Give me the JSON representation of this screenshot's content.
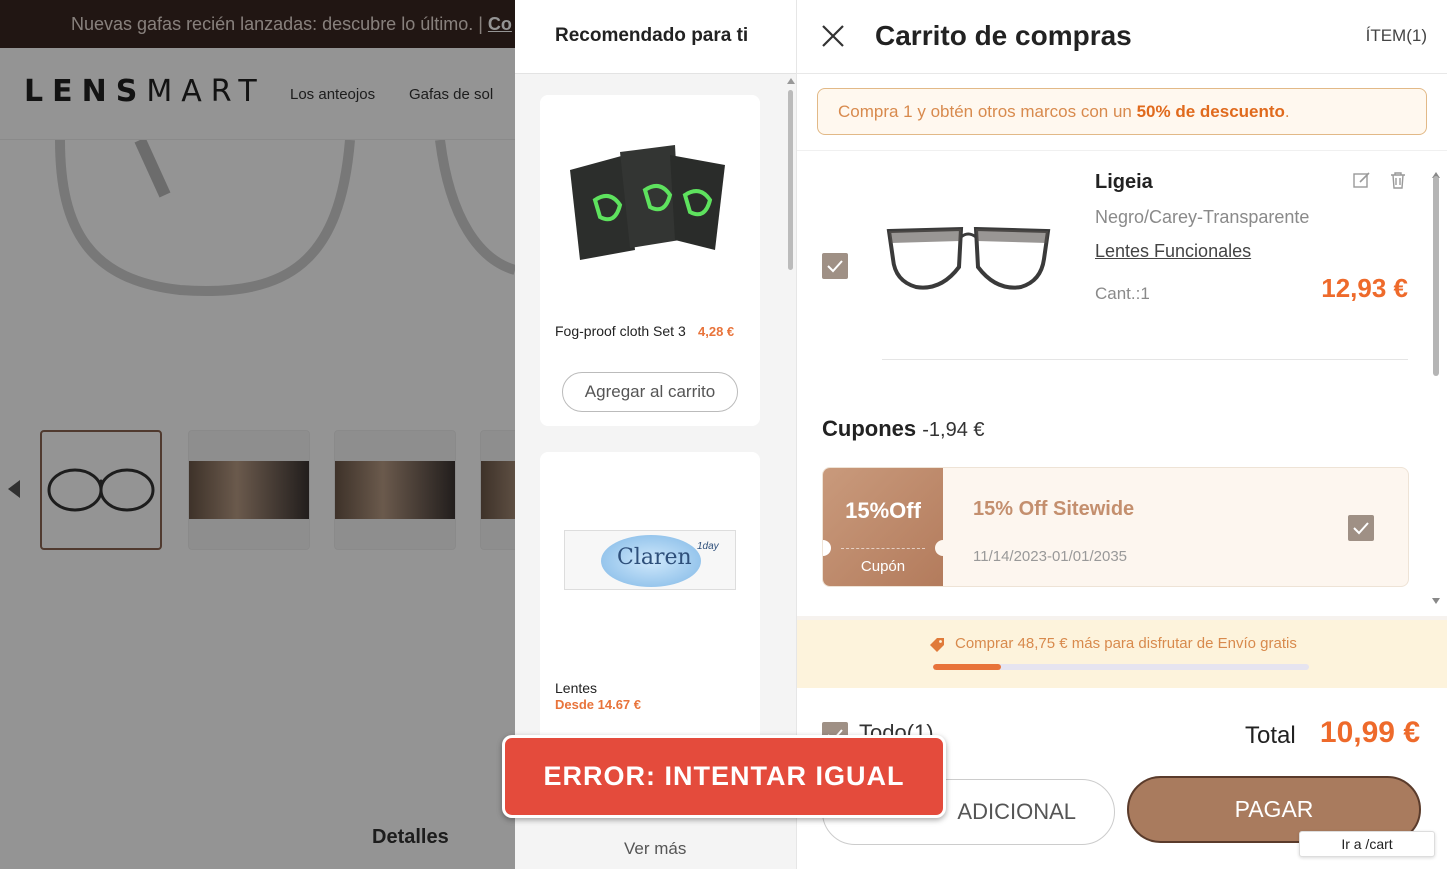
{
  "background": {
    "announcement": "Nuevas gafas recién lanzadas: descubre lo último. | ",
    "announcement_cta": "Co",
    "logo_bold": "LENS",
    "logo_thin": "MART",
    "nav": [
      "Los anteojos",
      "Gafas de sol"
    ],
    "details_tab": "Detalles"
  },
  "recommendations": {
    "title": "Recomendado para ti",
    "products": [
      {
        "name": "Fog-proof cloth Set 3",
        "price": "4,28 €",
        "add_label": "Agregar al carrito"
      },
      {
        "name": "Lentes",
        "price": "Desde 14.67 €",
        "image_text": "Claren",
        "image_sup": "1day"
      }
    ],
    "more_label": "Ver más"
  },
  "cart": {
    "title": "Carrito de compras",
    "items_count": "ÍTEM(1)",
    "promo_text": "Compra 1 y obtén otros marcos con un ",
    "promo_highlight": "50% de descuento",
    "promo_end": ".",
    "item": {
      "name": "Ligeia",
      "color": "Negro/Carey-Transparente",
      "lens": "Lentes Funcionales",
      "qty": "Cant.:1",
      "price": "12,93 €",
      "checked": true
    },
    "coupons": {
      "label": "Cupones",
      "amount": "-1,94 €",
      "coupon": {
        "badge": "15%Off",
        "tag": "Cupón",
        "title": "15% Off Sitewide",
        "dates": "11/14/2023-01/01/2035",
        "checked": true
      }
    },
    "shipping": {
      "text": "Comprar 48,75 € más para disfrutar de Envío gratis",
      "progress": 0.18
    },
    "footer": {
      "all_label": "Todo(1)",
      "total_label": "Total",
      "total_value": "10,99 €",
      "extra_button": "ADICIONAL",
      "pay_button": "PAGAR",
      "link_tooltip": "Ir a /cart"
    }
  },
  "error_toast": "ERROR: INTENTAR IGUAL",
  "colors": {
    "accent_orange": "#ee6a2b",
    "brand_brown": "#a97b5e",
    "checkbox": "#9f9085",
    "error_red": "#e44b3c"
  }
}
